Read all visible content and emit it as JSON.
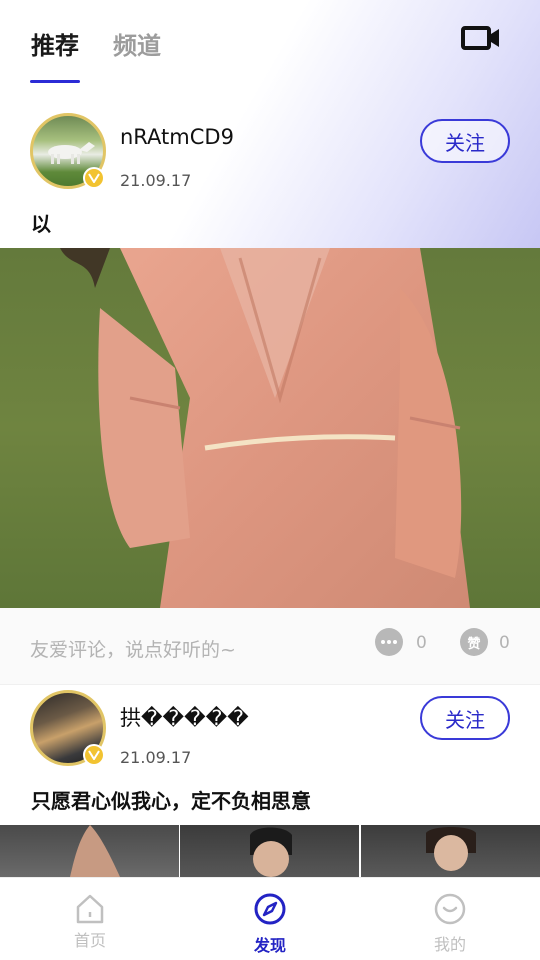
{
  "tabs": [
    {
      "label": "推荐",
      "active": true
    },
    {
      "label": "频道",
      "active": false
    }
  ],
  "header": {
    "video_icon": "video-camera-icon"
  },
  "posts": [
    {
      "username": "nRAtmCD9",
      "date": "21.09.17",
      "follow_label": "关注",
      "caption": "以",
      "verified": true
    },
    {
      "username": "拱�����",
      "date": "21.09.17",
      "follow_label": "关注",
      "caption": "只愿君心似我心，定不负相思意",
      "verified": true
    }
  ],
  "comment_bar": {
    "placeholder": "友爱评论，说点好听的~",
    "comment_count": "0",
    "like_icon_text": "赞",
    "like_count": "0"
  },
  "bottom_nav": [
    {
      "label": "首页",
      "icon": "home-icon",
      "active": false
    },
    {
      "label": "发现",
      "icon": "compass-icon",
      "active": true
    },
    {
      "label": "我的",
      "icon": "profile-icon",
      "active": false
    }
  ],
  "colors": {
    "accent": "#2b2bd6",
    "verified_badge": "#f2c331",
    "inactive": "#c0c0c0"
  }
}
